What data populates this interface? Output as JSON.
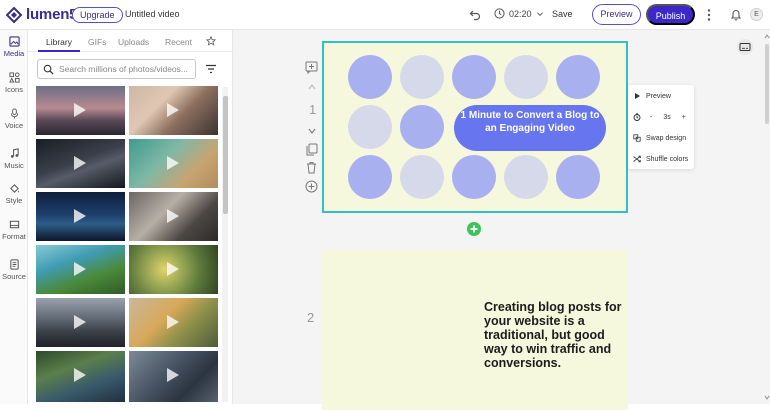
{
  "topbar": {
    "brand": "lumen5",
    "upgrade_label": "Upgrade",
    "video_title": "Untitled video",
    "duration": "02:20",
    "save_label": "Save",
    "preview_label": "Preview",
    "publish_label": "Publish",
    "avatar_initial": "E",
    "brand_color": "#3d27c9"
  },
  "leftnav": {
    "items": [
      {
        "label": "Media",
        "icon": "image-icon"
      },
      {
        "label": "Icons",
        "icon": "shapes-icon"
      },
      {
        "label": "Voice",
        "icon": "microphone-icon"
      },
      {
        "label": "Music",
        "icon": "music-note-icon"
      },
      {
        "label": "Style",
        "icon": "paint-bucket-icon"
      },
      {
        "label": "Format",
        "icon": "crop-icon"
      },
      {
        "label": "Source",
        "icon": "document-icon"
      }
    ]
  },
  "media": {
    "tabs": [
      "Library",
      "GIFs",
      "Uploads",
      "Recent"
    ],
    "search_placeholder": "Search millions of photos/videos..."
  },
  "slides": {
    "slide1_number": "1",
    "slide1_title": "1 Minute to Convert a Blog to an Engaging Video",
    "slide2_number": "2",
    "slide2_text": "Creating blog posts for your website is a traditional, but good way to win traffic and conversions."
  },
  "slide_menu": {
    "preview_label": "Preview",
    "duration_value": "3s",
    "minus_label": "-",
    "plus_label": "+",
    "swap_label": "Swap design",
    "shuffle_label": "Shuffle colors"
  }
}
